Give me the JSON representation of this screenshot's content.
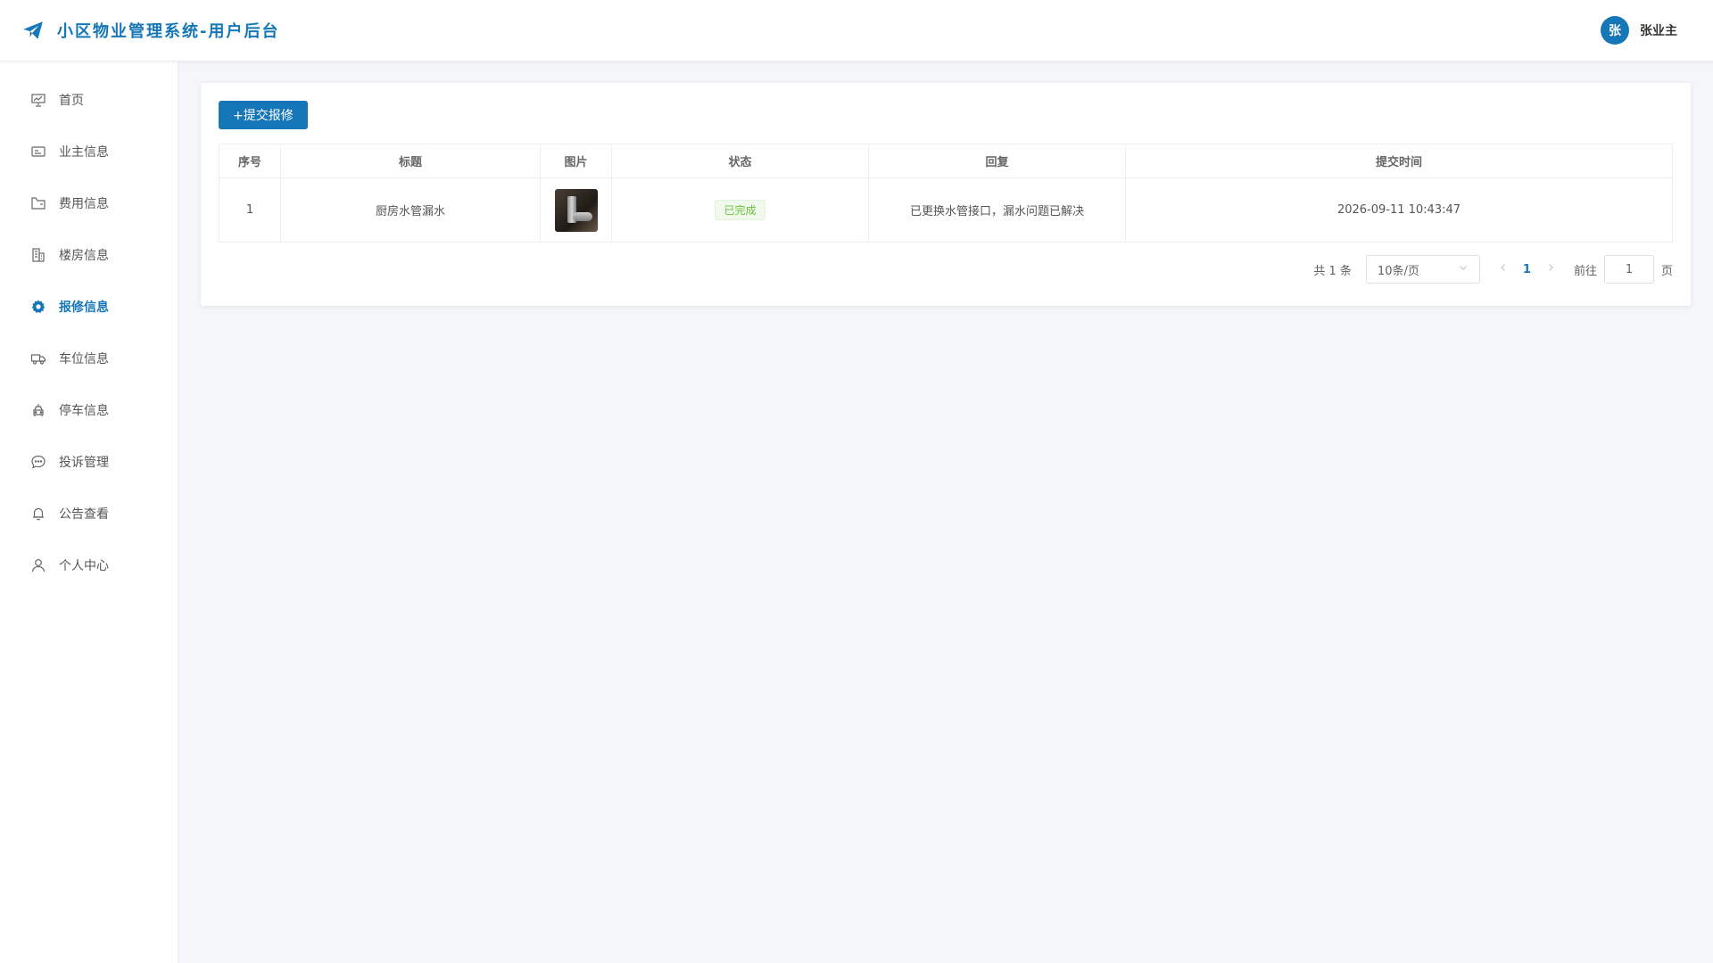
{
  "header": {
    "title": "小区物业管理系统-用户后台",
    "avatar_text": "张",
    "user_name": "张业主"
  },
  "sidebar": {
    "items": [
      {
        "label": "首页",
        "icon": "presentation-chart-icon"
      },
      {
        "label": "业主信息",
        "icon": "id-card-icon"
      },
      {
        "label": "费用信息",
        "icon": "wallet-icon"
      },
      {
        "label": "楼房信息",
        "icon": "building-icon"
      },
      {
        "label": "报修信息",
        "icon": "gear-icon",
        "active": true
      },
      {
        "label": "车位信息",
        "icon": "truck-icon"
      },
      {
        "label": "停车信息",
        "icon": "parking-icon"
      },
      {
        "label": "投诉管理",
        "icon": "chat-bubble-icon"
      },
      {
        "label": "公告查看",
        "icon": "bell-icon"
      },
      {
        "label": "个人中心",
        "icon": "user-icon"
      }
    ]
  },
  "toolbar": {
    "submit_label": "+提交报修"
  },
  "table": {
    "columns": [
      "序号",
      "标题",
      "图片",
      "状态",
      "回复",
      "提交时间"
    ],
    "rows": [
      {
        "index": "1",
        "title": "厨房水管漏水",
        "status": "已完成",
        "reply": "已更换水管接口，漏水问题已解决",
        "time": "2026-09-11 10:43:47"
      }
    ]
  },
  "pagination": {
    "total": "共 1 条",
    "page_size": "10条/页",
    "current_page": "1",
    "goto_label": "前往",
    "goto_value": "1",
    "page_suffix": "页"
  },
  "colors": {
    "primary": "#1677b8",
    "success": "#67c23a"
  }
}
